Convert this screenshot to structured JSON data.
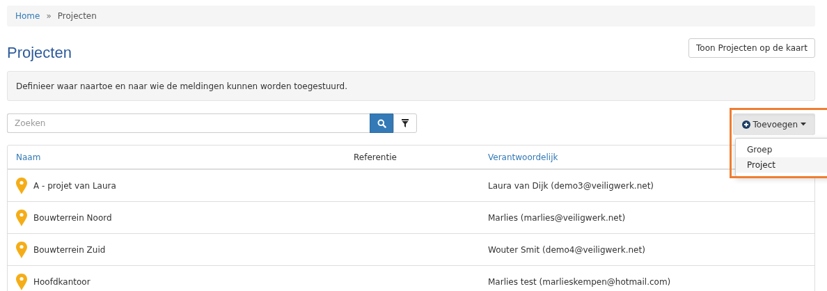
{
  "breadcrumb": {
    "items": [
      {
        "label": "Home",
        "kind": "link"
      },
      {
        "label": "Projecten",
        "kind": "current"
      }
    ],
    "separator": "»"
  },
  "title": "Projecten",
  "map_button": "Toon Projecten op de kaart",
  "info": "Definieer waar naartoe en naar wie de meldingen kunnen worden toegestuurd.",
  "search": {
    "placeholder": "Zoeken"
  },
  "add_button": {
    "label": "Toevoegen",
    "expanded": true,
    "highlighted": true
  },
  "add_menu": [
    {
      "label": "Groep",
      "selected": false
    },
    {
      "label": "Project",
      "selected": true
    }
  ],
  "table": {
    "columns": [
      {
        "label": "Naam",
        "sortable": true
      },
      {
        "label": "Referentie",
        "sortable": false
      },
      {
        "label": "Verantwoordelijk",
        "sortable": true
      }
    ],
    "rows": [
      {
        "name": "A - projet van Laura",
        "responsible": "Laura van Dijk (demo3@veiligwerk.net)"
      },
      {
        "name": "Bouwterrein Noord",
        "responsible": "Marlies (marlies@veiligwerk.net)"
      },
      {
        "name": "Bouwterrein Zuid",
        "responsible": "Wouter Smit (demo4@veiligwerk.net)"
      },
      {
        "name": "Hoofdkantoor",
        "responsible": "Marlies test (marlieskempen@hotmail.com)"
      }
    ]
  }
}
